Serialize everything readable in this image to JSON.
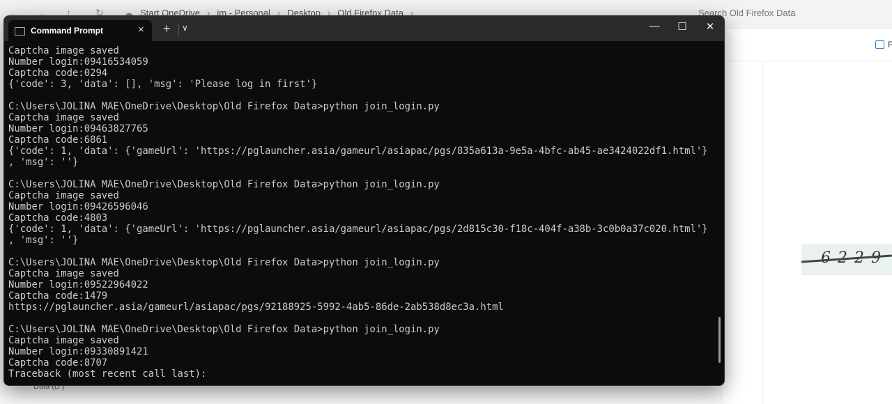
{
  "explorer": {
    "breadcrumbs": [
      "Start OneDrive",
      "im - Personal",
      "Desktop",
      "Old Firefox Data"
    ],
    "search_placeholder": "Search Old Firefox Data",
    "preview_label": "P",
    "nav_item": "Data (D:)",
    "captcha_text": "6229"
  },
  "terminal": {
    "tab_title": "Command Prompt",
    "lines": [
      "Captcha image saved",
      "Number login:09416534059",
      "Captcha code:0294",
      "{'code': 3, 'data': [], 'msg': 'Please log in first'}",
      "",
      "C:\\Users\\JOLINA MAE\\OneDrive\\Desktop\\Old Firefox Data>python join_login.py",
      "Captcha image saved",
      "Number login:09463827765",
      "Captcha code:6861",
      "{'code': 1, 'data': {'gameUrl': 'https://pglauncher.asia/gameurl/asiapac/pgs/835a613a-9e5a-4bfc-ab45-ae3424022df1.html'}",
      ", 'msg': ''}",
      "",
      "C:\\Users\\JOLINA MAE\\OneDrive\\Desktop\\Old Firefox Data>python join_login.py",
      "Captcha image saved",
      "Number login:09426596046",
      "Captcha code:4803",
      "{'code': 1, 'data': {'gameUrl': 'https://pglauncher.asia/gameurl/asiapac/pgs/2d815c30-f18c-404f-a38b-3c0b0a37c020.html'}",
      ", 'msg': ''}",
      "",
      "C:\\Users\\JOLINA MAE\\OneDrive\\Desktop\\Old Firefox Data>python join_login.py",
      "Captcha image saved",
      "Number login:09522964022",
      "Captcha code:1479",
      "https://pglauncher.asia/gameurl/asiapac/pgs/92188925-5992-4ab5-86de-2ab538d8ec3a.html",
      "",
      "C:\\Users\\JOLINA MAE\\OneDrive\\Desktop\\Old Firefox Data>python join_login.py",
      "Captcha image saved",
      "Number login:09330891421",
      "Captcha code:8707",
      "Traceback (most recent call last):"
    ]
  },
  "icons": {
    "back": "arrow-left",
    "forward": "arrow-right",
    "up": "arrow-up",
    "refresh": "refresh",
    "onedrive": "cloud-off",
    "close": "×",
    "new_tab": "+",
    "dropdown": "⌄",
    "minimize": "—",
    "maximize": "☐",
    "window_close": "✕"
  }
}
